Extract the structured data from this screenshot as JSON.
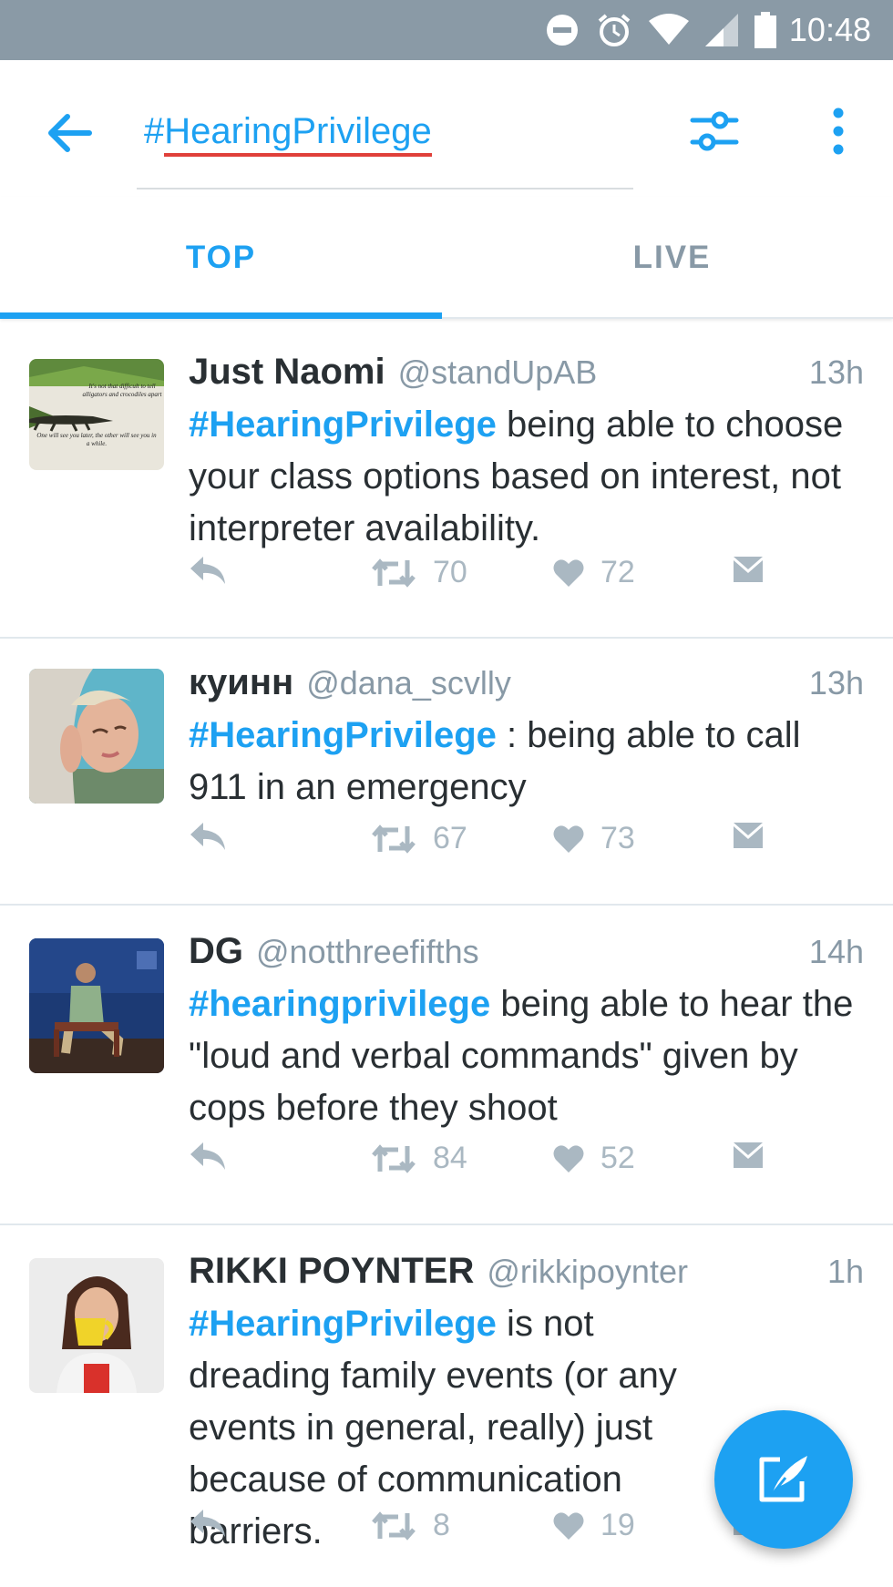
{
  "status_bar": {
    "time": "10:48",
    "icons": [
      "do-not-disturb-icon",
      "alarm-icon",
      "wifi-icon",
      "signal-icon",
      "battery-icon"
    ]
  },
  "search": {
    "query": "#HearingPrivilege"
  },
  "tabs": [
    {
      "label": "TOP",
      "active": true
    },
    {
      "label": "LIVE",
      "active": false
    }
  ],
  "colors": {
    "accent": "#1da1f2",
    "status_bar": "#8a9aa6",
    "muted": "#8899a6",
    "spellcheck": "#e0403a"
  },
  "tweets": [
    {
      "name": "Just Naomi",
      "handle": "@standUpAB",
      "time": "13h",
      "hashtag": "#HearingPrivilege",
      "text": " being able to choose your class options based on interest, not interpreter availability.",
      "retweets": "70",
      "likes": "72",
      "avatar_text": [
        "It's not that difficult to tell alligators and crocodiles apart",
        "One will see you later, the other will see you in a while."
      ]
    },
    {
      "name": "куинн",
      "handle": "@dana_scvlly",
      "time": "13h",
      "hashtag": "#HearingPrivilege",
      "text": " : being able to call 911 in an emergency",
      "retweets": "67",
      "likes": "73"
    },
    {
      "name": "DG",
      "handle": "@notthreefifths",
      "time": "14h",
      "hashtag": "#hearingprivilege",
      "text": " being able to hear the \"loud and verbal commands\" given by cops before they shoot",
      "retweets": "84",
      "likes": "52"
    },
    {
      "name": "RIKKI POYNTER",
      "handle": "@rikkipoynter",
      "time": "1h",
      "hashtag": "#HearingPrivilege",
      "text": " is not dreading family events (or any events in general, really) just because of communication barriers.",
      "retweets": "8",
      "likes": "19"
    }
  ]
}
